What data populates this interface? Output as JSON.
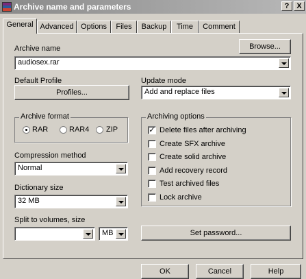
{
  "window": {
    "title": "Archive name and parameters",
    "help_label": "?",
    "close_label": "X"
  },
  "tabs": [
    "General",
    "Advanced",
    "Options",
    "Files",
    "Backup",
    "Time",
    "Comment"
  ],
  "archive_name": {
    "label": "Archive name",
    "value": "audiosex.rar",
    "browse_label": "Browse..."
  },
  "default_profile": {
    "label": "Default Profile",
    "button_label": "Profiles..."
  },
  "update_mode": {
    "label": "Update mode",
    "value": "Add and replace files"
  },
  "archive_format": {
    "label": "Archive format",
    "options": [
      "RAR",
      "RAR4",
      "ZIP"
    ],
    "selected": "RAR"
  },
  "compression_method": {
    "label": "Compression method",
    "value": "Normal"
  },
  "dictionary_size": {
    "label": "Dictionary size",
    "value": "32 MB"
  },
  "split_volumes": {
    "label": "Split to volumes, size",
    "value": "",
    "unit": "MB"
  },
  "archiving_options": {
    "label": "Archiving options",
    "items": [
      {
        "label": "Delete files after archiving",
        "checked": true
      },
      {
        "label": "Create SFX archive",
        "checked": false
      },
      {
        "label": "Create solid archive",
        "checked": false
      },
      {
        "label": "Add recovery record",
        "checked": false
      },
      {
        "label": "Test archived files",
        "checked": false
      },
      {
        "label": "Lock archive",
        "checked": false
      }
    ]
  },
  "set_password_label": "Set password...",
  "footer": {
    "ok_label": "OK",
    "cancel_label": "Cancel",
    "help_label": "Help"
  }
}
